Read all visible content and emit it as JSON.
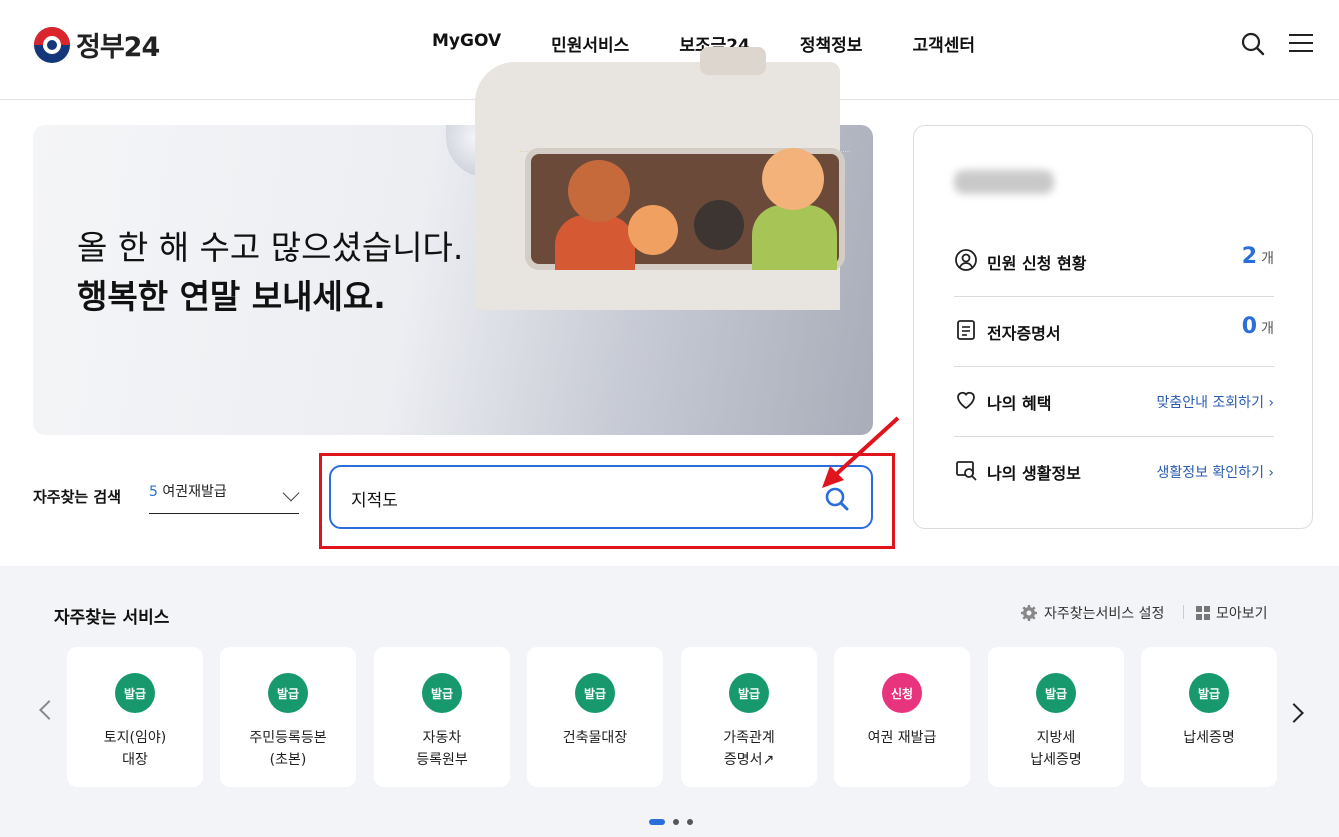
{
  "header": {
    "logo_text": "정부24",
    "nav": [
      "MyGOV",
      "민원서비스",
      "보조금24",
      "정책정보",
      "고객센터"
    ]
  },
  "banner": {
    "line1": "올 한 해 수고 많으셨습니다.",
    "line2": "행복한 연말 보내세요."
  },
  "search": {
    "freq_label": "자주찾는 검색",
    "freq_rank": "5",
    "freq_term": "여권재발급",
    "query": "지적도"
  },
  "panel": {
    "rows": [
      {
        "label": "민원 신청 현황",
        "count": "2",
        "unit": "개"
      },
      {
        "label": "전자증명서",
        "count": "0",
        "unit": "개"
      },
      {
        "label": "나의 혜택",
        "link": "맞춤안내 조회하기 ›"
      },
      {
        "label": "나의 생활정보",
        "link": "생활정보 확인하기 ›"
      }
    ]
  },
  "services": {
    "title": "자주찾는 서비스",
    "setting_label": "자주찾는서비스 설정",
    "all_label": "모아보기",
    "items": [
      {
        "badge": "발급",
        "line1": "토지(임야)",
        "line2": "대장"
      },
      {
        "badge": "발급",
        "line1": "주민등록등본",
        "line2": "(초본)"
      },
      {
        "badge": "발급",
        "line1": "자동차",
        "line2": "등록원부"
      },
      {
        "badge": "발급",
        "line1": "건축물대장",
        "line2": ""
      },
      {
        "badge": "발급",
        "line1": "가족관계",
        "line2": "증명서↗"
      },
      {
        "badge": "신청",
        "line1": "여권 재발급",
        "line2": ""
      },
      {
        "badge": "발급",
        "line1": "지방세",
        "line2": "납세증명"
      },
      {
        "badge": "발급",
        "line1": "납세증명",
        "line2": ""
      }
    ]
  },
  "colors": {
    "accent": "#2a6edc",
    "badge_green": "#17996d",
    "badge_pink": "#e8347d",
    "annotation_red": "#e0141c"
  }
}
